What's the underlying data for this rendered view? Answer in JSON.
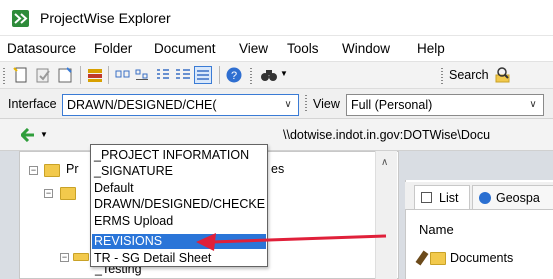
{
  "window": {
    "title": "ProjectWise Explorer"
  },
  "menubar": {
    "items": [
      "Datasource",
      "Folder",
      "Document",
      "View",
      "Tools",
      "Window",
      "Help"
    ]
  },
  "toolbar": {
    "search_label": "Search"
  },
  "interface_toolbar": {
    "label": "Interface",
    "selected_value": "DRAWN/DESIGNED/CHE(",
    "view_label": "View",
    "view_value": "Full (Personal)"
  },
  "interface_dropdown": {
    "options": [
      "_PROJECT INFORMATION",
      "_SIGNATURE",
      "Default",
      "DRAWN/DESIGNED/CHECKEI",
      "ERMS Upload",
      "REVISIONS",
      "TR - SG Detail Sheet"
    ],
    "highlighted": "REVISIONS"
  },
  "address_bar": {
    "path": "\\\\dotwise.indot.in.gov:DOTWise\\Docu"
  },
  "tree": {
    "root_label_partial": "Pr",
    "right_partial": "es",
    "child_partial": "_Testing"
  },
  "right_pane": {
    "tabs": [
      "List",
      "Geospa"
    ],
    "column_header": "Name",
    "rows": [
      "Documents"
    ]
  },
  "colors": {
    "selection": "#2a75d8",
    "annotation_arrow": "#e0203a",
    "app_icon": "#2e8b3a"
  }
}
